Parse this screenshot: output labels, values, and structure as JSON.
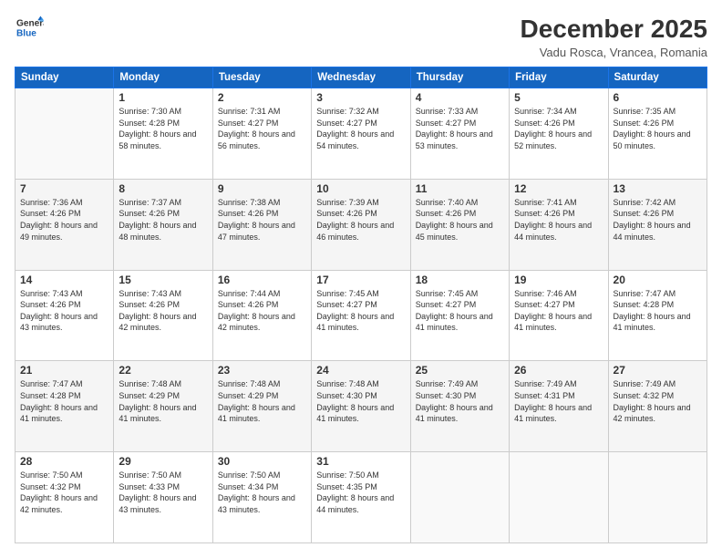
{
  "header": {
    "logo_line1": "General",
    "logo_line2": "Blue",
    "month": "December 2025",
    "location": "Vadu Rosca, Vrancea, Romania"
  },
  "days_of_week": [
    "Sunday",
    "Monday",
    "Tuesday",
    "Wednesday",
    "Thursday",
    "Friday",
    "Saturday"
  ],
  "weeks": [
    [
      {
        "day": "",
        "sunrise": "",
        "sunset": "",
        "daylight": ""
      },
      {
        "day": "1",
        "sunrise": "Sunrise: 7:30 AM",
        "sunset": "Sunset: 4:28 PM",
        "daylight": "Daylight: 8 hours and 58 minutes."
      },
      {
        "day": "2",
        "sunrise": "Sunrise: 7:31 AM",
        "sunset": "Sunset: 4:27 PM",
        "daylight": "Daylight: 8 hours and 56 minutes."
      },
      {
        "day": "3",
        "sunrise": "Sunrise: 7:32 AM",
        "sunset": "Sunset: 4:27 PM",
        "daylight": "Daylight: 8 hours and 54 minutes."
      },
      {
        "day": "4",
        "sunrise": "Sunrise: 7:33 AM",
        "sunset": "Sunset: 4:27 PM",
        "daylight": "Daylight: 8 hours and 53 minutes."
      },
      {
        "day": "5",
        "sunrise": "Sunrise: 7:34 AM",
        "sunset": "Sunset: 4:26 PM",
        "daylight": "Daylight: 8 hours and 52 minutes."
      },
      {
        "day": "6",
        "sunrise": "Sunrise: 7:35 AM",
        "sunset": "Sunset: 4:26 PM",
        "daylight": "Daylight: 8 hours and 50 minutes."
      }
    ],
    [
      {
        "day": "7",
        "sunrise": "Sunrise: 7:36 AM",
        "sunset": "Sunset: 4:26 PM",
        "daylight": "Daylight: 8 hours and 49 minutes."
      },
      {
        "day": "8",
        "sunrise": "Sunrise: 7:37 AM",
        "sunset": "Sunset: 4:26 PM",
        "daylight": "Daylight: 8 hours and 48 minutes."
      },
      {
        "day": "9",
        "sunrise": "Sunrise: 7:38 AM",
        "sunset": "Sunset: 4:26 PM",
        "daylight": "Daylight: 8 hours and 47 minutes."
      },
      {
        "day": "10",
        "sunrise": "Sunrise: 7:39 AM",
        "sunset": "Sunset: 4:26 PM",
        "daylight": "Daylight: 8 hours and 46 minutes."
      },
      {
        "day": "11",
        "sunrise": "Sunrise: 7:40 AM",
        "sunset": "Sunset: 4:26 PM",
        "daylight": "Daylight: 8 hours and 45 minutes."
      },
      {
        "day": "12",
        "sunrise": "Sunrise: 7:41 AM",
        "sunset": "Sunset: 4:26 PM",
        "daylight": "Daylight: 8 hours and 44 minutes."
      },
      {
        "day": "13",
        "sunrise": "Sunrise: 7:42 AM",
        "sunset": "Sunset: 4:26 PM",
        "daylight": "Daylight: 8 hours and 44 minutes."
      }
    ],
    [
      {
        "day": "14",
        "sunrise": "Sunrise: 7:43 AM",
        "sunset": "Sunset: 4:26 PM",
        "daylight": "Daylight: 8 hours and 43 minutes."
      },
      {
        "day": "15",
        "sunrise": "Sunrise: 7:43 AM",
        "sunset": "Sunset: 4:26 PM",
        "daylight": "Daylight: 8 hours and 42 minutes."
      },
      {
        "day": "16",
        "sunrise": "Sunrise: 7:44 AM",
        "sunset": "Sunset: 4:26 PM",
        "daylight": "Daylight: 8 hours and 42 minutes."
      },
      {
        "day": "17",
        "sunrise": "Sunrise: 7:45 AM",
        "sunset": "Sunset: 4:27 PM",
        "daylight": "Daylight: 8 hours and 41 minutes."
      },
      {
        "day": "18",
        "sunrise": "Sunrise: 7:45 AM",
        "sunset": "Sunset: 4:27 PM",
        "daylight": "Daylight: 8 hours and 41 minutes."
      },
      {
        "day": "19",
        "sunrise": "Sunrise: 7:46 AM",
        "sunset": "Sunset: 4:27 PM",
        "daylight": "Daylight: 8 hours and 41 minutes."
      },
      {
        "day": "20",
        "sunrise": "Sunrise: 7:47 AM",
        "sunset": "Sunset: 4:28 PM",
        "daylight": "Daylight: 8 hours and 41 minutes."
      }
    ],
    [
      {
        "day": "21",
        "sunrise": "Sunrise: 7:47 AM",
        "sunset": "Sunset: 4:28 PM",
        "daylight": "Daylight: 8 hours and 41 minutes."
      },
      {
        "day": "22",
        "sunrise": "Sunrise: 7:48 AM",
        "sunset": "Sunset: 4:29 PM",
        "daylight": "Daylight: 8 hours and 41 minutes."
      },
      {
        "day": "23",
        "sunrise": "Sunrise: 7:48 AM",
        "sunset": "Sunset: 4:29 PM",
        "daylight": "Daylight: 8 hours and 41 minutes."
      },
      {
        "day": "24",
        "sunrise": "Sunrise: 7:48 AM",
        "sunset": "Sunset: 4:30 PM",
        "daylight": "Daylight: 8 hours and 41 minutes."
      },
      {
        "day": "25",
        "sunrise": "Sunrise: 7:49 AM",
        "sunset": "Sunset: 4:30 PM",
        "daylight": "Daylight: 8 hours and 41 minutes."
      },
      {
        "day": "26",
        "sunrise": "Sunrise: 7:49 AM",
        "sunset": "Sunset: 4:31 PM",
        "daylight": "Daylight: 8 hours and 41 minutes."
      },
      {
        "day": "27",
        "sunrise": "Sunrise: 7:49 AM",
        "sunset": "Sunset: 4:32 PM",
        "daylight": "Daylight: 8 hours and 42 minutes."
      }
    ],
    [
      {
        "day": "28",
        "sunrise": "Sunrise: 7:50 AM",
        "sunset": "Sunset: 4:32 PM",
        "daylight": "Daylight: 8 hours and 42 minutes."
      },
      {
        "day": "29",
        "sunrise": "Sunrise: 7:50 AM",
        "sunset": "Sunset: 4:33 PM",
        "daylight": "Daylight: 8 hours and 43 minutes."
      },
      {
        "day": "30",
        "sunrise": "Sunrise: 7:50 AM",
        "sunset": "Sunset: 4:34 PM",
        "daylight": "Daylight: 8 hours and 43 minutes."
      },
      {
        "day": "31",
        "sunrise": "Sunrise: 7:50 AM",
        "sunset": "Sunset: 4:35 PM",
        "daylight": "Daylight: 8 hours and 44 minutes."
      },
      {
        "day": "",
        "sunrise": "",
        "sunset": "",
        "daylight": ""
      },
      {
        "day": "",
        "sunrise": "",
        "sunset": "",
        "daylight": ""
      },
      {
        "day": "",
        "sunrise": "",
        "sunset": "",
        "daylight": ""
      }
    ]
  ]
}
